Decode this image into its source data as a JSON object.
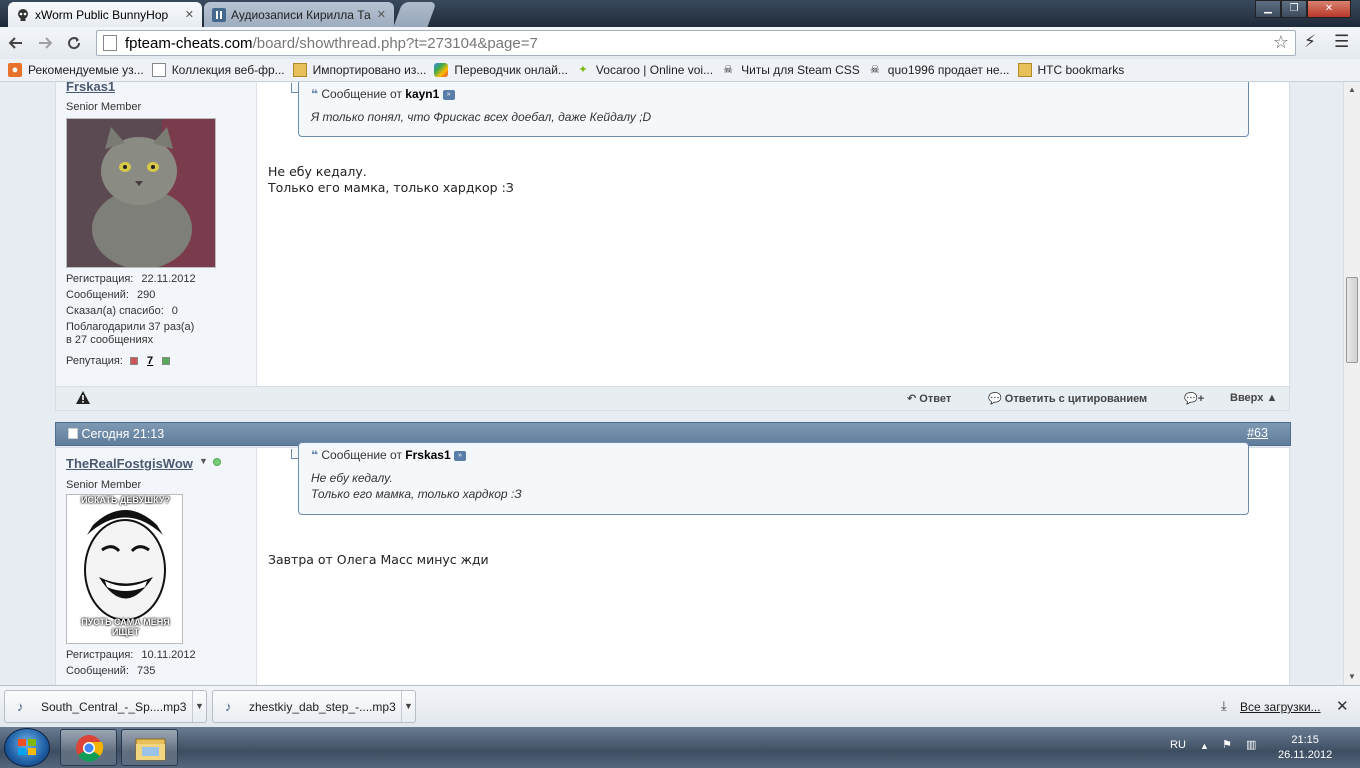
{
  "browser": {
    "tabs": [
      {
        "title": "xWorm Public BunnyHop",
        "active": true
      },
      {
        "title": "Аудиозаписи Кирилла Та",
        "active": false
      }
    ],
    "url_host": "fpteam-cheats.com",
    "url_path": "/board/showthread.php?t=273104&page=7"
  },
  "bookmarks": [
    {
      "label": "Рекомендуемые уз...",
      "icon": "bookmark-icon"
    },
    {
      "label": "Коллекция веб-фр...",
      "icon": "page-icon"
    },
    {
      "label": "Импортировано из...",
      "icon": "folder-icon"
    },
    {
      "label": "Переводчик онлай...",
      "icon": "translate-icon"
    },
    {
      "label": "Vocaroo | Online voi...",
      "icon": "vocaroo-icon"
    },
    {
      "label": "Читы для Steam CSS",
      "icon": "skull-icon"
    },
    {
      "label": "quo1996 продает не...",
      "icon": "skull-icon"
    },
    {
      "label": "HTC bookmarks",
      "icon": "folder-icon"
    }
  ],
  "post1": {
    "username": "Frskas1",
    "usertitle": "Senior Member",
    "reg_label": "Регистрация:",
    "reg_value": "22.11.2012",
    "msgs_label": "Сообщений:",
    "msgs_value": "290",
    "thanks_label": "Сказал(а) спасибо:",
    "thanks_value": "0",
    "thanked_line1": "Поблагодарили 37 раз(а)",
    "thanked_line2": "в 27 сообщениях",
    "rep_label": "Репутация:",
    "rep_value": "7",
    "quote_prefix": "Сообщение от",
    "quote_author": "kayn1",
    "quote_text": "Я только понял, что Фрискас всех доебал, даже Кейдалу ;D",
    "message_line1": "Не ебу кедалу.",
    "message_line2": "Только его мамка, только хардкор :З"
  },
  "post_footer": {
    "reply": "Ответ",
    "reply_quote": "Ответить с цитированием",
    "top": "Вверх"
  },
  "post2": {
    "date": "Сегодня 21:13",
    "number": "#63",
    "username": "TheRealFostgisWow",
    "usertitle": "Senior Member",
    "avatar_top": "ИСКАТЬ ДЕВУШКУ?",
    "avatar_bottom": "ПУСТЬ САМА МЕНЯ ИЩЕТ",
    "reg_label": "Регистрация:",
    "reg_value": "10.11.2012",
    "msgs_label": "Сообщений:",
    "msgs_value": "735",
    "quote_prefix": "Сообщение от",
    "quote_author": "Frskas1",
    "quote_line1": "Не ебу кедалу.",
    "quote_line2": "Только его мамка, только хардкор :З",
    "message": "Завтра от Олега Масс минус жди"
  },
  "downloads": {
    "items": [
      "South_Central_-_Sp....mp3",
      "zhestkiy_dab_step_-....mp3"
    ],
    "all": "Все загрузки..."
  },
  "taskbar": {
    "lang": "RU",
    "time": "21:15",
    "date": "26.11.2012"
  }
}
